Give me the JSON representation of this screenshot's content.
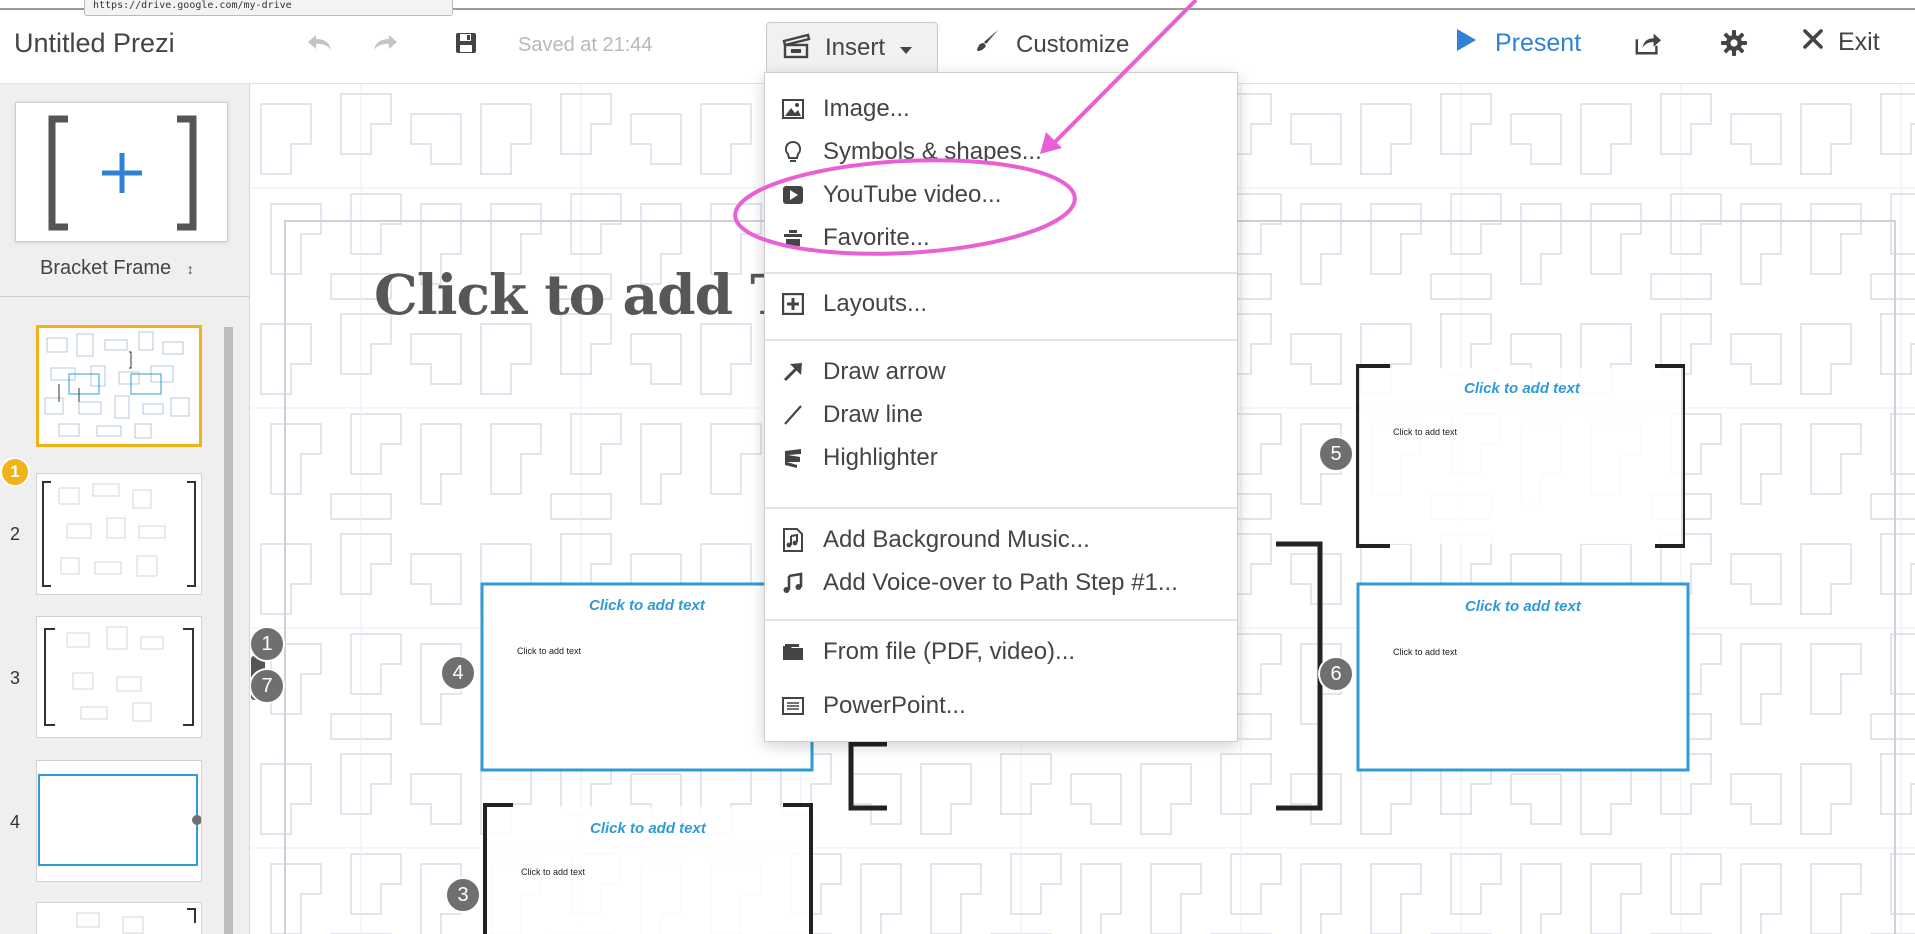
{
  "toolbar": {
    "url_tooltip": "https://drive.google.com/my-drive",
    "title": "Untitled Prezi",
    "saved_text": "Saved at 21:44",
    "insert_label": "Insert",
    "customize_label": "Customize",
    "present_label": "Present",
    "exit_label": "Exit",
    "accent_color": "#2f80d6"
  },
  "sidebar": {
    "frame_type_label": "Bracket Frame",
    "selected_color": "#f2b318",
    "steps": [
      {
        "num": "1"
      },
      {
        "num": "2"
      },
      {
        "num": "3"
      },
      {
        "num": "4"
      }
    ]
  },
  "canvas": {
    "title_text": "Click to add T",
    "cta_text": "Click to add text",
    "small_text": "Click to add text",
    "badges": [
      "1",
      "7",
      "4",
      "5",
      "6",
      "3"
    ]
  },
  "insert_menu": {
    "items": [
      {
        "label": "Image...",
        "icon": "image-icon"
      },
      {
        "label": "Symbols & shapes...",
        "icon": "lightbulb-icon"
      },
      {
        "label": "YouTube video...",
        "icon": "youtube-play-icon"
      },
      {
        "label": "Favorite...",
        "icon": "favorite-icon"
      },
      {
        "label": "Layouts...",
        "icon": "layouts-plus-icon"
      },
      {
        "label": "Draw arrow",
        "icon": "arrow-icon"
      },
      {
        "label": "Draw line",
        "icon": "line-icon"
      },
      {
        "label": "Highlighter",
        "icon": "highlighter-icon"
      },
      {
        "label": "Add Background Music...",
        "icon": "music-file-icon"
      },
      {
        "label": "Add Voice-over to Path Step #1...",
        "icon": "music-note-icon"
      },
      {
        "label": "From file (PDF, video)...",
        "icon": "folder-icon"
      },
      {
        "label": "PowerPoint...",
        "icon": "powerpoint-icon"
      }
    ]
  },
  "annotation_color": "#e85fd6"
}
